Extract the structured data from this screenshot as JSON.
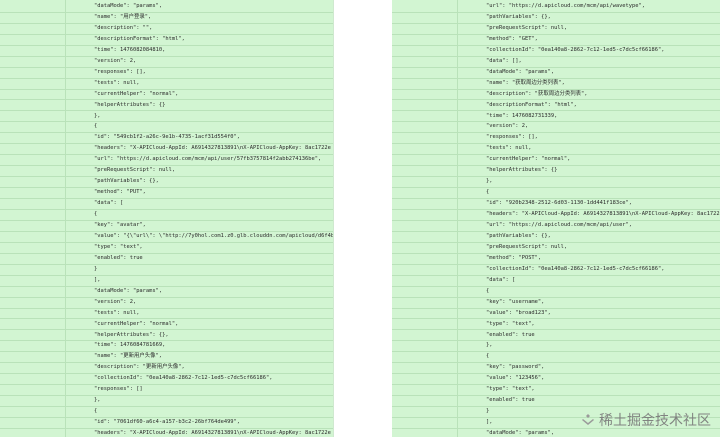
{
  "left_lines": [
    "\"dataMode\": \"params\",",
    "\"name\": \"用户登录\",",
    "\"description\": \"\",",
    "\"descriptionFormat\": \"html\",",
    "\"time\": 1476082084810,",
    "\"version\": 2,",
    "\"responses\": [],",
    "\"tests\": null,",
    "\"currentHelper\": \"normal\",",
    "\"helperAttributes\": {}",
    "},",
    "{",
    "\"id\": \"549cb1f2-a26c-9e1b-4735-1acf31d554f0\",",
    "\"headers\": \"X-APICloud-AppId: A6914327813891\\nX-APICloud-AppKey: 8ac1722e",
    "\"url\": \"https://d.apicloud.com/mcm/api/user/57fb3757814f2abb274136be\",",
    "\"preRequestScript\": null,",
    "\"pathVariables\": {},",
    "\"method\": \"PUT\",",
    "\"data\": [",
    "{",
    "\"key\": \"avatar\",",
    "\"value\": \"{\\\"url\\\": \\\"http://7y0hol.com1.z0.glb.clouddn.com/apicloud/d6f4b",
    "\"type\": \"text\",",
    "\"enabled\": true",
    "}",
    "],",
    "\"dataMode\": \"params\",",
    "\"version\": 2,",
    "\"tests\": null,",
    "\"currentHelper\": \"normal\",",
    "\"helperAttributes\": {},",
    "\"time\": 1476084781669,",
    "\"name\": \"更新用户头像\",",
    "\"description\": \"更新用户头像\",",
    "\"collectionId\": \"0ea140a8-2862-7c12-1ed5-c7dc5cf66186\",",
    "\"responses\": []",
    "},",
    "{",
    "\"id\": \"7061df60-a6c4-a157-b3c2-26bf764de499\",",
    "\"headers\": \"X-APICloud-AppId: A6914327813891\\nX-APICloud-AppKey: 8ac1722e"
  ],
  "right_lines": [
    "\"url\": \"https://d.apicloud.com/mcm/api/wavetype\",",
    "\"pathVariables\": {},",
    "\"preRequestScript\": null,",
    "\"method\": \"GET\",",
    "\"collectionId\": \"0ea140a8-2862-7c12-1ed5-c7dc5cf66186\",",
    "\"data\": [],",
    "\"dataMode\": \"params\",",
    "\"name\": \"获取周边分类列表\",",
    "\"description\": \"获取周边分类列表\",",
    "\"descriptionFormat\": \"html\",",
    "\"time\": 1476082731339,",
    "\"version\": 2,",
    "\"responses\": [],",
    "\"tests\": null,",
    "\"currentHelper\": \"normal\",",
    "\"helperAttributes\": {}",
    "},",
    "{",
    "\"id\": \"920b2348-2512-6d03-1130-1dd441f183ce\",",
    "\"headers\": \"X-APICloud-AppId: A6914327813891\\nX-APICloud-AppKey: 8ac1722e",
    "\"url\": \"https://d.apicloud.com/mcm/api/user\",",
    "\"pathVariables\": {},",
    "\"preRequestScript\": null,",
    "\"method\": \"POST\",",
    "\"collectionId\": \"0ea140a8-2862-7c12-1ed5-c7dc5cf66186\",",
    "\"data\": [",
    "{",
    "\"key\": \"username\",",
    "\"value\": \"broad123\",",
    "\"type\": \"text\",",
    "\"enabled\": true",
    "},",
    "{",
    "\"key\": \"password\",",
    "\"value\": \"123456\",",
    "\"type\": \"text\",",
    "\"enabled\": true",
    "}",
    "],",
    "\"dataMode\": \"params\","
  ],
  "watermark": "稀土掘金技术社区",
  "colors": {
    "row_bg": "#d2f5d2",
    "row_border": "#b9e2b9"
  }
}
